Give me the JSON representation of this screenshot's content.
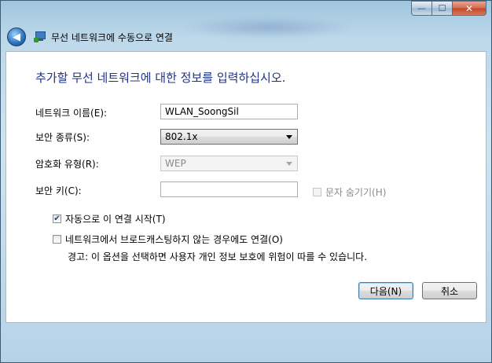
{
  "window": {
    "minimize_glyph": "—",
    "maximize_glyph": "☐",
    "close_glyph": "✕"
  },
  "nav": {
    "title": "무선 네트워크에 수동으로 연결",
    "back_icon": "back-arrow-icon",
    "app_icon": "wireless-network-icon"
  },
  "form": {
    "heading": "추가할 무선 네트워크에 대한 정보를 입력하십시오.",
    "network_name_label": "네트워크 이름(E):",
    "network_name_value": "WLAN_SoongSil",
    "security_type_label": "보안 종류(S):",
    "security_type_value": "802.1x",
    "encryption_type_label": "암호화 유형(R):",
    "encryption_type_value": "WEP",
    "security_key_label": "보안 키(C):",
    "security_key_value": "",
    "hide_chars_label": "문자 숨기기(H)",
    "hide_chars_checked": false,
    "auto_start_label": "자동으로 이 연결 시작(T)",
    "auto_start_checked": true,
    "connect_non_broadcast_label": "네트워크에서 브로드캐스팅하지 않는 경우에도 연결(O)",
    "connect_non_broadcast_checked": false,
    "warning_text": "경고: 이 옵션을 선택하면 사용자 개인 정보 보호에 위험이 따를 수 있습니다."
  },
  "buttons": {
    "next": "다음(N)",
    "cancel": "취소"
  }
}
